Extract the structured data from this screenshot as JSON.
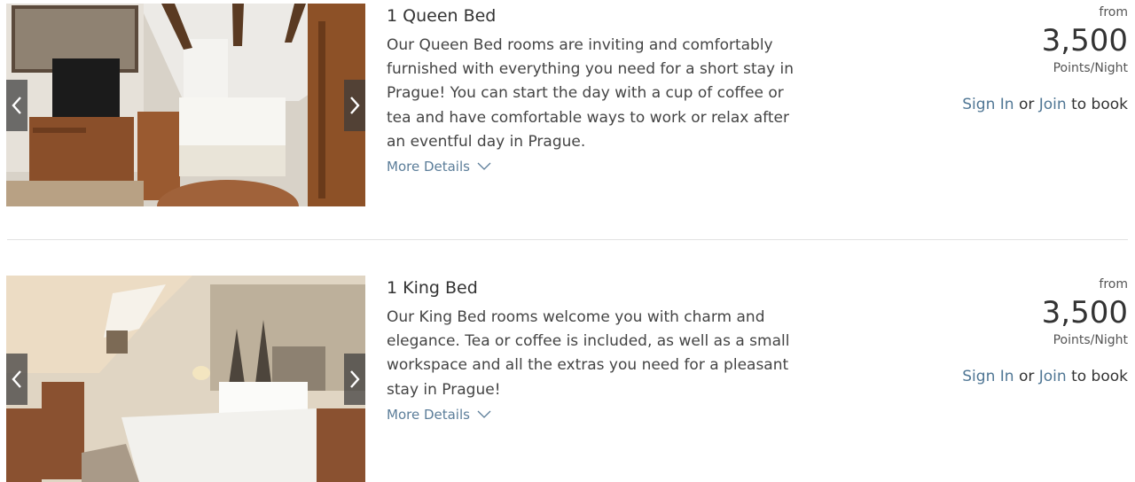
{
  "rooms": [
    {
      "title": "1 Queen Bed",
      "description": "Our Queen Bed rooms are inviting and comfortably furnished with everything you need for a short stay in Prague! You can start the day with a cup of coffee or tea and have comfortable ways to work or relax after an eventful day in Prague.",
      "more_details": "More Details",
      "from": "from",
      "points": "3,500",
      "per_night": "Points/Night",
      "sign_in": "Sign In",
      "or": "or",
      "join": "Join",
      "to_book": "to book"
    },
    {
      "title": "1 King Bed",
      "description": "Our King Bed rooms welcome you with charm and elegance. Tea or coffee is included, as well as a small workspace and all the extras you need for a pleasant stay in Prague!",
      "more_details": "More Details",
      "from": "from",
      "points": "3,500",
      "per_night": "Points/Night",
      "sign_in": "Sign In",
      "or": "or",
      "join": "Join",
      "to_book": "to book"
    }
  ],
  "icons": {
    "prev": "chevron-left-icon",
    "next": "chevron-right-icon",
    "expand": "chevron-down-icon"
  },
  "colors": {
    "link": "#4f7694",
    "more_details": "#5b7d99",
    "divider": "#e2e2e2",
    "arrow_bg": "#3c3c3c"
  }
}
